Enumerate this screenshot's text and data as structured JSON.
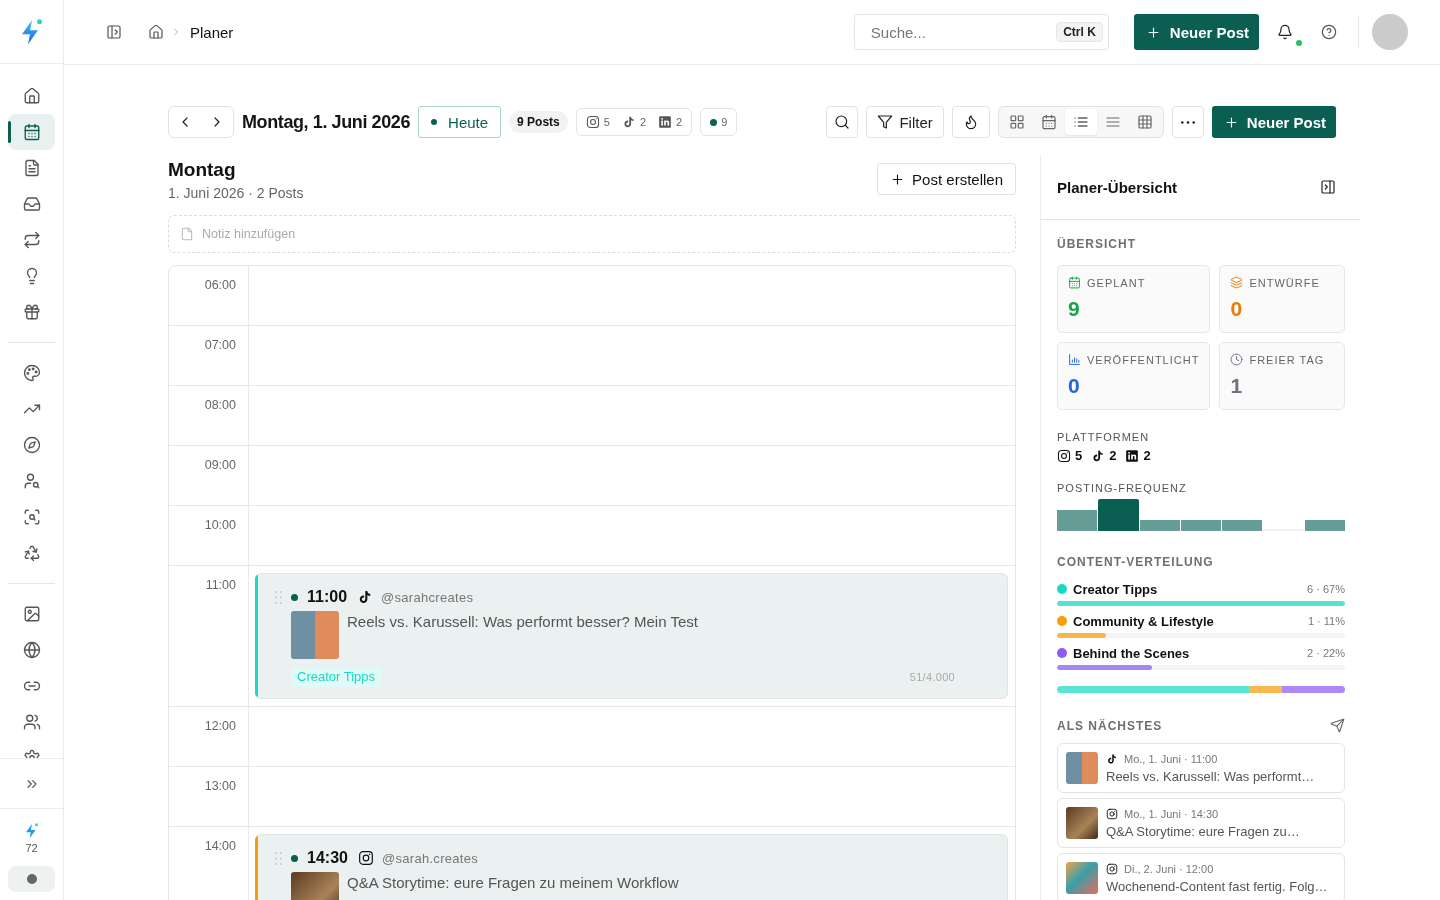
{
  "header": {
    "breadcrumb": "Planer",
    "search": {
      "placeholder": "Suche...",
      "shortcut": "Ctrl K"
    },
    "new_post": "Neuer Post",
    "notifications": {
      "unread": true
    }
  },
  "sidebar": {
    "groups": [
      {
        "items": [
          {
            "selected": false
          },
          {
            "selected": true
          },
          {
            "selected": false
          },
          {
            "selected": false
          },
          {
            "selected": false
          },
          {
            "selected": false
          },
          {
            "selected": false
          }
        ]
      },
      {
        "items": [
          {
            "selected": false
          },
          {
            "selected": false
          },
          {
            "selected": false
          },
          {
            "selected": false
          },
          {
            "selected": false
          },
          {
            "selected": false
          }
        ]
      },
      {
        "items": [
          {
            "selected": false
          },
          {
            "selected": false
          },
          {
            "selected": false
          },
          {
            "selected": false
          },
          {
            "selected": false
          }
        ]
      }
    ],
    "credits": "72"
  },
  "toolbar": {
    "date": "Montag, 1. Juni 2026",
    "today": "Heute",
    "post_count": "9 Posts",
    "platforms": [
      {
        "kind": "instagram",
        "count": "5"
      },
      {
        "kind": "tiktok",
        "count": "2"
      },
      {
        "kind": "linkedin",
        "count": "2"
      }
    ],
    "statuses": [
      {
        "color": "#0b5e52",
        "count": "9"
      }
    ],
    "filter": "Filter",
    "views": [
      {
        "selected": false
      },
      {
        "selected": false
      },
      {
        "selected": true
      },
      {
        "selected": false
      },
      {
        "selected": false
      }
    ],
    "new_post": "Neuer Post"
  },
  "day": {
    "title": "Montag",
    "subtitle": "1. Juni 2026 · 2 Posts",
    "create_button": "Post erstellen",
    "note": {
      "placeholder": "Notiz hinzufügen"
    },
    "hours": [
      {
        "time": "06:00"
      },
      {
        "time": "07:00"
      },
      {
        "time": "08:00"
      },
      {
        "time": "09:00"
      },
      {
        "time": "10:00"
      },
      {
        "time": "11:00",
        "posts": [
          {
            "time": "11:00",
            "kind": "tiktok",
            "handle": "@sarahcreates",
            "title": "Reels vs. Karussell: Was performt besser? Mein Test",
            "tag": "Creator Tipps",
            "color": "#19d9c5",
            "char_count": "51/4.000"
          }
        ]
      },
      {
        "time": "12:00"
      },
      {
        "time": "13:00"
      },
      {
        "time": "14:00",
        "posts": [
          {
            "time": "14:30",
            "kind": "instagram",
            "handle": "@sarah.creates",
            "title": "Q&A Storytime: eure Fragen zu meinem Workflow",
            "color": "#f59e0b"
          }
        ]
      }
    ]
  },
  "panel": {
    "title": "Planer-Übersicht",
    "overview": {
      "label": "ÜBERSICHT",
      "stats": [
        {
          "label": "GEPLANT",
          "value": "9",
          "color": "#16a34a"
        },
        {
          "label": "ENTWÜRFE",
          "value": "0",
          "color": "#ea7c0c"
        },
        {
          "label": "VERÖFFENTLICHT",
          "value": "0",
          "color": "#2563eb"
        },
        {
          "label": "FREIER TAG",
          "value": "1",
          "color": "#6b7280"
        }
      ]
    },
    "platforms": {
      "label": "PLATTFORMEN",
      "items": [
        {
          "kind": "instagram",
          "count": "5"
        },
        {
          "kind": "tiktok",
          "count": "2"
        },
        {
          "kind": "linkedin",
          "count": "2"
        }
      ]
    },
    "frequency": {
      "label": "POSTING-FREQUENZ",
      "bars": [
        {
          "selected": false
        },
        {
          "selected": true
        },
        {
          "selected": false
        },
        {
          "selected": false
        },
        {
          "selected": false
        },
        {
          "selected": false
        },
        {
          "selected": false
        }
      ]
    },
    "distribution": {
      "label": "CONTENT-VERTEILUNG",
      "categories": [
        {
          "name": "Creator Tipps",
          "stats": "6 · 67%",
          "color": "#19d9c5",
          "level": 1
        },
        {
          "name": "Community & Lifestyle",
          "stats": "1 · 11%",
          "color": "#f59e0b",
          "level": 0.17
        },
        {
          "name": "Behind the Scenes",
          "stats": "2 · 22%",
          "color": "#8b5cf6",
          "level": 0.33
        }
      ]
    },
    "upcoming": {
      "label": "ALS NÄCHSTES",
      "items": [
        {
          "kind": "tiktok",
          "date": "Mo., 1. Juni · 11:00",
          "title": "Reels vs. Karussell: Was performt…"
        },
        {
          "kind": "instagram",
          "date": "Mo., 1. Juni · 14:30",
          "title": "Q&A Storytime: eure Fragen zu…"
        },
        {
          "kind": "instagram",
          "date": "Di., 2. Juni · 12:00",
          "title": "Wochenend-Content fast fertig. Folg…"
        }
      ]
    }
  }
}
